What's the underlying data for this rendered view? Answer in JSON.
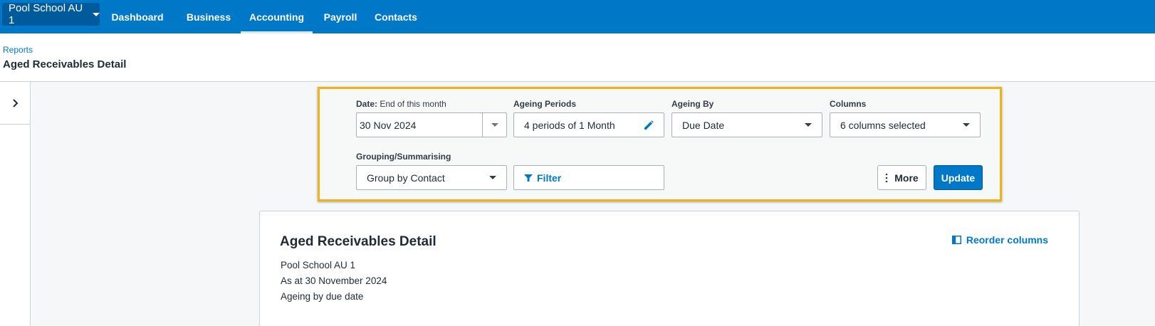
{
  "nav": {
    "org_name": "Pool School AU 1",
    "tabs": [
      {
        "label": "Dashboard"
      },
      {
        "label": "Business"
      },
      {
        "label": "Accounting"
      },
      {
        "label": "Payroll"
      },
      {
        "label": "Contacts"
      }
    ],
    "active_tab": "Accounting"
  },
  "header": {
    "breadcrumb": "Reports",
    "title": "Aged Receivables Detail"
  },
  "settings": {
    "date": {
      "label": "Date:",
      "sublabel": "End of this month",
      "value": "30 Nov 2024"
    },
    "ageing_periods": {
      "label": "Ageing Periods",
      "value": "4 periods of 1 Month"
    },
    "ageing_by": {
      "label": "Ageing By",
      "value": "Due Date"
    },
    "columns": {
      "label": "Columns",
      "value": "6 columns selected"
    },
    "grouping": {
      "label": "Grouping/Summarising",
      "value": "Group by Contact"
    },
    "filter_label": "Filter",
    "more_label": "More",
    "update_label": "Update"
  },
  "report": {
    "title": "Aged Receivables Detail",
    "reorder_label": "Reorder columns",
    "org_line": "Pool School AU 1",
    "as_at_line": "As at 30 November 2024",
    "ageing_line": "Ageing by due date"
  },
  "colors": {
    "brand_blue": "#0078c8",
    "highlight_border": "#f2b21a"
  },
  "icons": [
    "chevron-down-icon",
    "chevron-right-icon",
    "pencil-icon",
    "filter-icon",
    "more-vertical-icon",
    "columns-icon"
  ]
}
